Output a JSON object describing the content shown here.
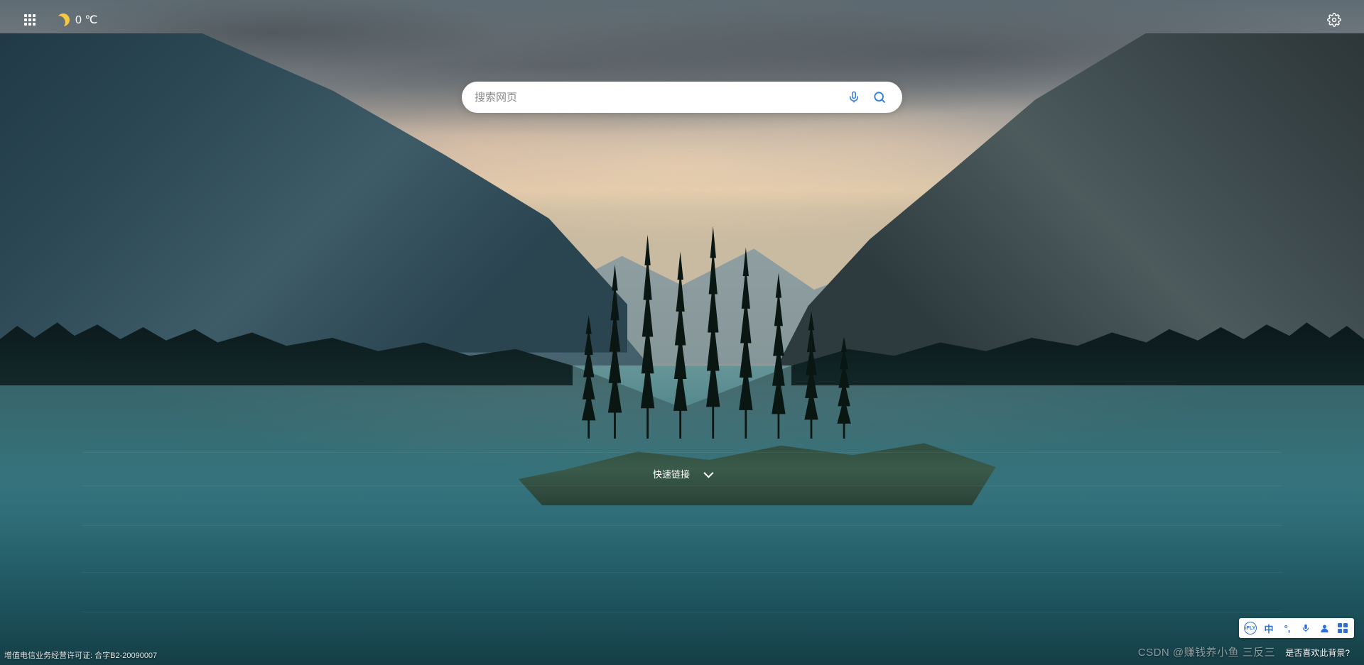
{
  "header": {
    "weather": {
      "temperature_display": "0 ℃",
      "condition_icon": "moon"
    }
  },
  "search": {
    "placeholder": "搜索网页"
  },
  "quick_links": {
    "label": "快速链接"
  },
  "footer": {
    "legal": "增值电信业务经营许可证: 合字B2-20090007",
    "watermark": "CSDN @赚钱养小鱼 三反三",
    "background_feedback": "是否喜欢此背景?"
  },
  "ime": {
    "logo": "iFLY",
    "lang": "中",
    "punct": "°,"
  }
}
